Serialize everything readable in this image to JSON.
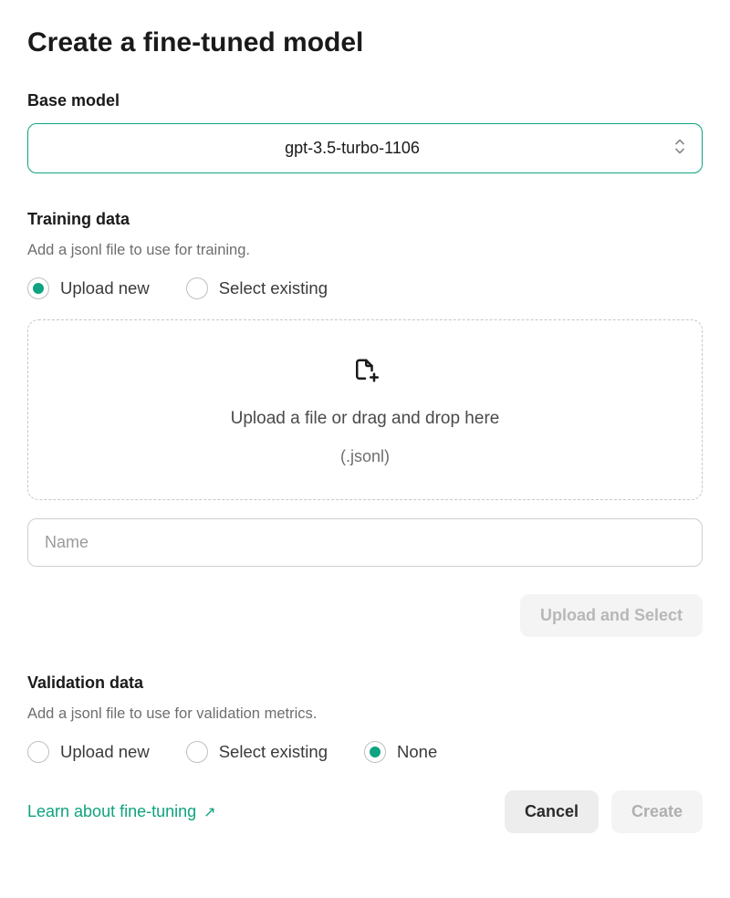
{
  "title": "Create a fine-tuned model",
  "base_model": {
    "label": "Base model",
    "value": "gpt-3.5-turbo-1106"
  },
  "training": {
    "label": "Training data",
    "description": "Add a jsonl file to use for training.",
    "options": {
      "upload_new": "Upload new",
      "select_existing": "Select existing"
    },
    "selected": "upload_new",
    "dropzone": {
      "icon": "file-add-icon",
      "text": "Upload a file or drag and drop here",
      "subtext": "(.jsonl)"
    },
    "name_placeholder": "Name",
    "upload_button": "Upload and Select"
  },
  "validation": {
    "label": "Validation data",
    "description": "Add a jsonl file to use for validation metrics.",
    "options": {
      "upload_new": "Upload new",
      "select_existing": "Select existing",
      "none": "None"
    },
    "selected": "none"
  },
  "footer": {
    "learn_link": "Learn about fine-tuning",
    "cancel": "Cancel",
    "create": "Create"
  }
}
